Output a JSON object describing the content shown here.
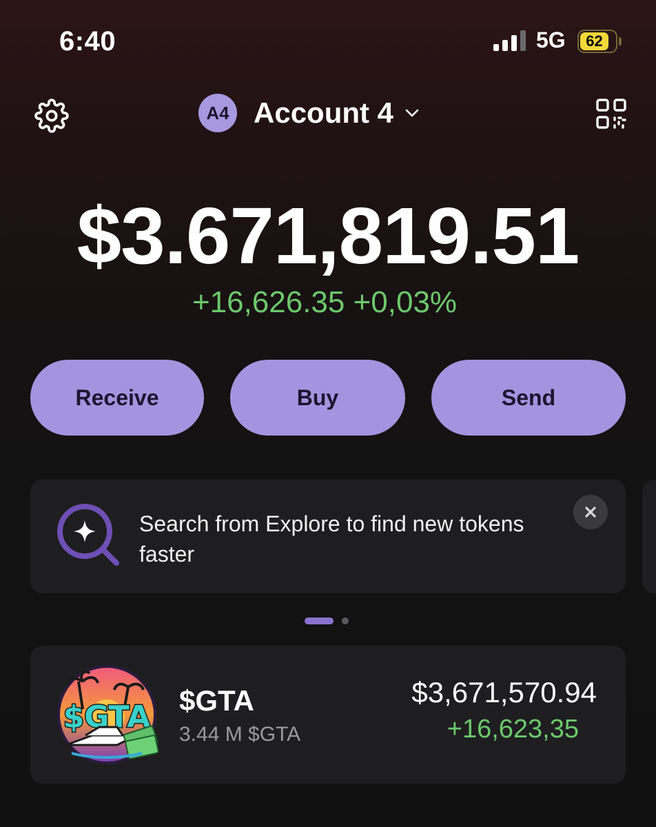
{
  "status_bar": {
    "time": "6:40",
    "network": "5G",
    "battery": "62",
    "battery_level": 0.62
  },
  "header": {
    "avatar_initials": "A4",
    "account_name": "Account 4",
    "settings_icon": "gear-icon",
    "qr_icon": "qr-scan-icon",
    "dropdown_icon": "chevron-down-icon"
  },
  "portfolio": {
    "balance": "$3.671,819.51",
    "change": "+16,626.35 +0,03%"
  },
  "actions": {
    "receive": "Receive",
    "buy": "Buy",
    "send": "Send"
  },
  "banner": {
    "text": "Search from Explore to find new tokens faster",
    "icon": "search-sparkle-icon",
    "close_icon": "close-icon"
  },
  "pager": {
    "pages": 2,
    "active_index": 0
  },
  "tokens": [
    {
      "symbol": "$GTA",
      "amount": "3.44 M $GTA",
      "value": "$3,671,570.94",
      "change": "+16,623,35",
      "logo_text": "$GTA"
    }
  ],
  "colors": {
    "accent": "#a394df",
    "positive": "#6cc86c",
    "card": "#1e1e20"
  }
}
